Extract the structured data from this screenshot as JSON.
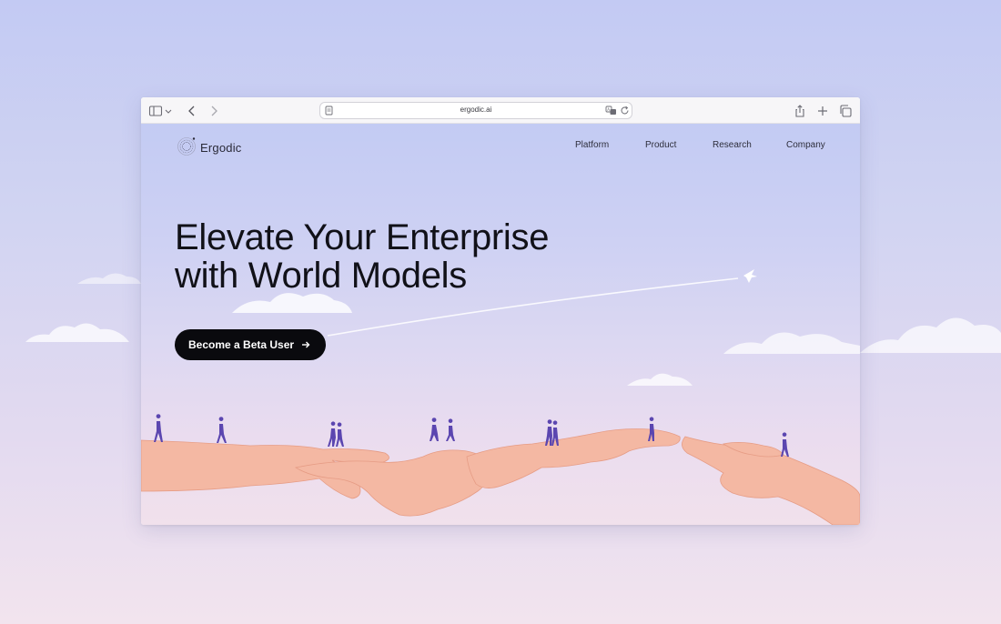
{
  "browser": {
    "url": "ergodic.ai",
    "icons": [
      "sidebar-icon",
      "chevron-down-icon",
      "back-icon",
      "forward-icon",
      "page-icon",
      "translate-icon",
      "reload-icon",
      "share-icon",
      "new-tab-icon",
      "tabs-overview-icon"
    ]
  },
  "site": {
    "logo_text": "Ergodic",
    "nav": [
      {
        "label": "Platform"
      },
      {
        "label": "Product"
      },
      {
        "label": "Research"
      },
      {
        "label": "Company"
      }
    ],
    "hero": {
      "headline_line1": "Elevate Your Enterprise",
      "headline_line2": "with World Models",
      "cta_label": "Become a Beta User"
    }
  },
  "colors": {
    "cta_bg": "#0a0a0e",
    "hand": "#f4b9a4",
    "figure": "#5b46b0",
    "background_top": "#c3cbf3",
    "background_bottom": "#f1e1ec"
  }
}
